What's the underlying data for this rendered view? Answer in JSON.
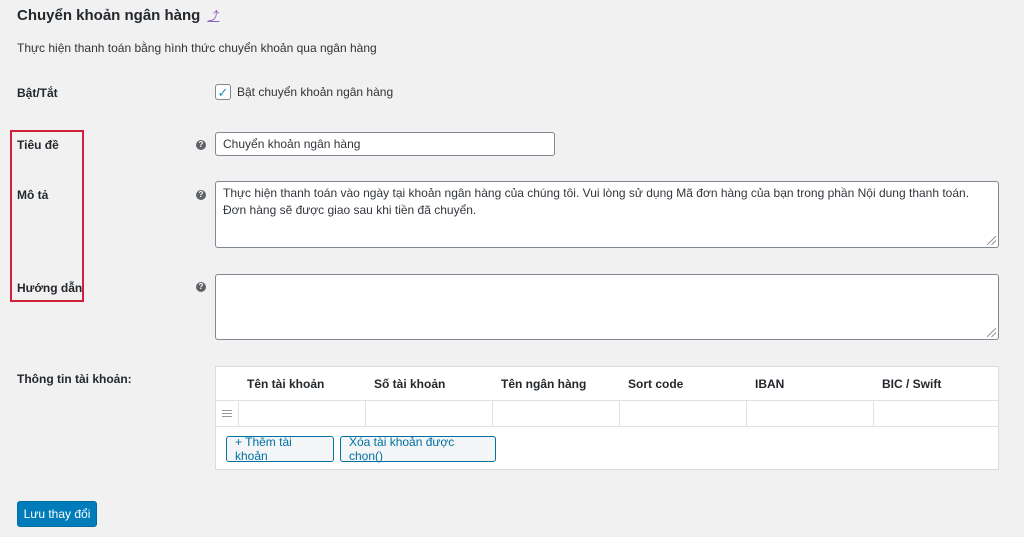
{
  "header": {
    "title": "Chuyển khoản ngân hàng",
    "up_icon": "up-arrow-icon",
    "description": "Thực hiện thanh toán bằng hình thức chuyển khoản qua ngân hàng"
  },
  "fields": {
    "enable": {
      "label": "Bật/Tắt",
      "checkbox_label": "Bật chuyển khoản ngân hàng",
      "checked": true
    },
    "title": {
      "label": "Tiêu đề",
      "value": "Chuyển khoản ngân hàng"
    },
    "description": {
      "label": "Mô tả",
      "value": "Thực hiện thanh toán vào ngày tại khoản ngân hàng của chúng tôi. Vui lòng sử dụng Mã đơn hàng của bạn trong phần Nội dung thanh toán. Đơn hàng sẽ được giao sau khi tiền đã chuyển."
    },
    "instructions": {
      "label": "Hướng dẫn",
      "value": ""
    }
  },
  "accounts": {
    "label": "Thông tin tài khoản:",
    "columns": [
      "Tên tài khoản",
      "Số tài khoản",
      "Tên ngân hàng",
      "Sort code",
      "IBAN",
      "BIC / Swift"
    ],
    "add_button": "+ Thêm tài khoản",
    "remove_button": "Xóa tài khoản được chọn()"
  },
  "save_button": "Lưu thay đổi",
  "icons": {
    "help": "help-icon",
    "check": "checkmark-icon",
    "drag": "drag-handle-icon"
  },
  "colors": {
    "accent": "#0071a1",
    "primary_button": "#007cba",
    "highlight_box": "#d0203a"
  }
}
